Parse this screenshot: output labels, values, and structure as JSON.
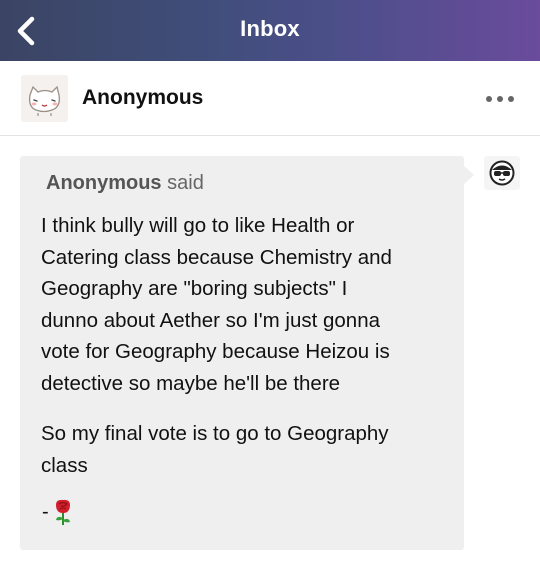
{
  "topbar": {
    "title": "Inbox",
    "back_icon": "chevron-left-icon",
    "gradient": [
      "#3b4463",
      "#6a4b9c"
    ]
  },
  "post_header": {
    "avatar_icon": "cat-avatar-icon",
    "name": "Anonymous",
    "more_icon": "more-horizontal-icon"
  },
  "ask": {
    "asker_name": "Anonymous",
    "asker_said": "said",
    "paragraph_1_lines": [
      "I think bully will go to like Health or",
      "Catering class because Chemistry and",
      "Geography are \"boring subjects\" I",
      "dunno about Aether so I'm just gonna",
      "vote for Geography because Heizou is",
      "detective so maybe he'll be there"
    ],
    "paragraph_2_lines": [
      "So my final vote is to go to Geography",
      "class"
    ],
    "signature_prefix": "-",
    "signature_icon": "rose-icon"
  },
  "answerer": {
    "avatar_icon": "sunglasses-avatar-icon"
  }
}
